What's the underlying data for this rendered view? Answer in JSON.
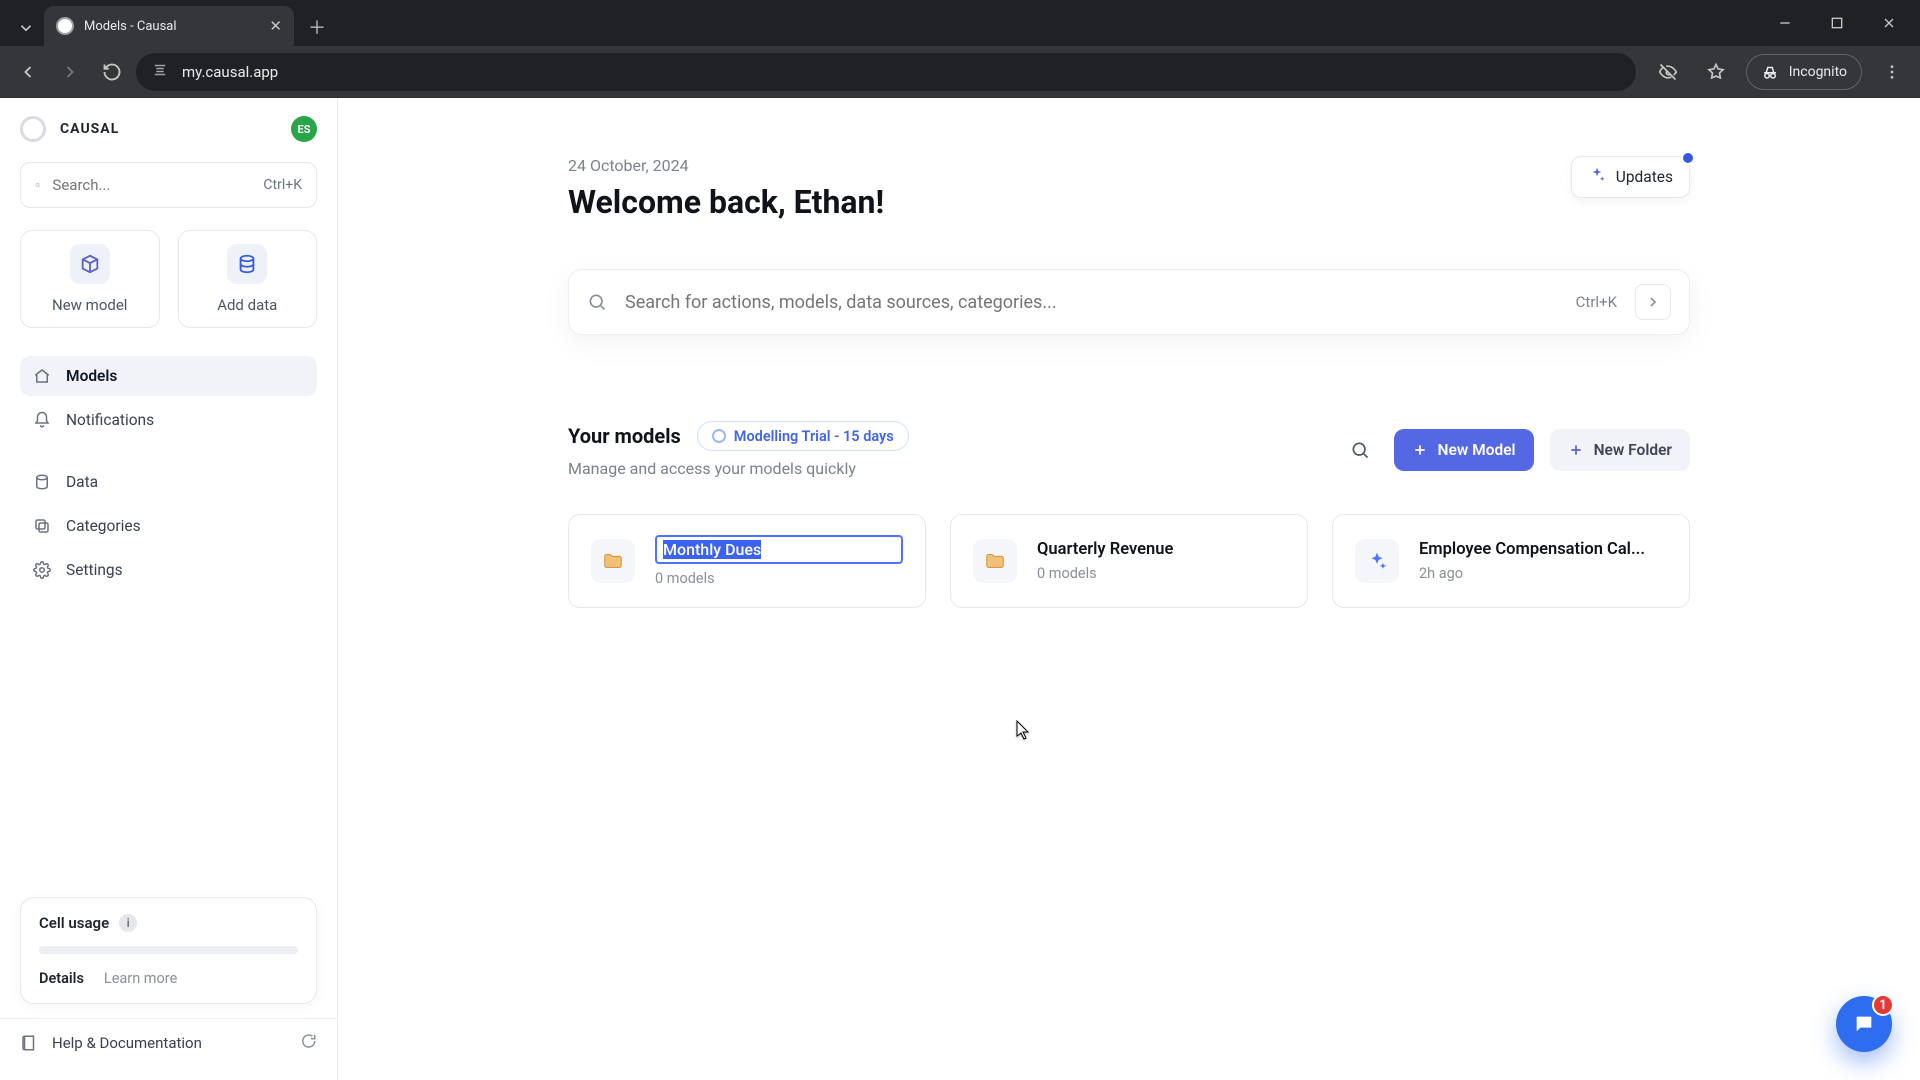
{
  "browser": {
    "tab_title": "Models - Causal",
    "url": "my.causal.app",
    "incognito_label": "Incognito"
  },
  "sidebar": {
    "brand": "CAUSAL",
    "avatar_initials": "ES",
    "search_placeholder": "Search...",
    "search_hint": "Ctrl+K",
    "quick": {
      "new_model": "New model",
      "add_data": "Add data"
    },
    "nav": {
      "models": "Models",
      "notifications": "Notifications",
      "data": "Data",
      "categories": "Categories",
      "settings": "Settings"
    },
    "usage": {
      "title": "Cell usage",
      "details": "Details",
      "learn_more": "Learn more"
    },
    "help": "Help & Documentation"
  },
  "header": {
    "date": "24 October, 2024",
    "welcome": "Welcome back, Ethan!",
    "updates_label": "Updates"
  },
  "search": {
    "placeholder": "Search for actions, models, data sources, categories...",
    "hint": "Ctrl+K"
  },
  "models_section": {
    "title": "Your models",
    "trial_label": "Modelling Trial - 15 days",
    "subtitle": "Manage and access your models quickly",
    "new_model": "New Model",
    "new_folder": "New Folder"
  },
  "cards": [
    {
      "type": "folder",
      "title": "Monthly Dues",
      "sub": "0 models",
      "editing": true
    },
    {
      "type": "folder",
      "title": "Quarterly Revenue",
      "sub": "0 models"
    },
    {
      "type": "model",
      "title": "Employee Compensation Cal...",
      "sub": "2h ago"
    }
  ],
  "chat": {
    "badge": "1"
  }
}
